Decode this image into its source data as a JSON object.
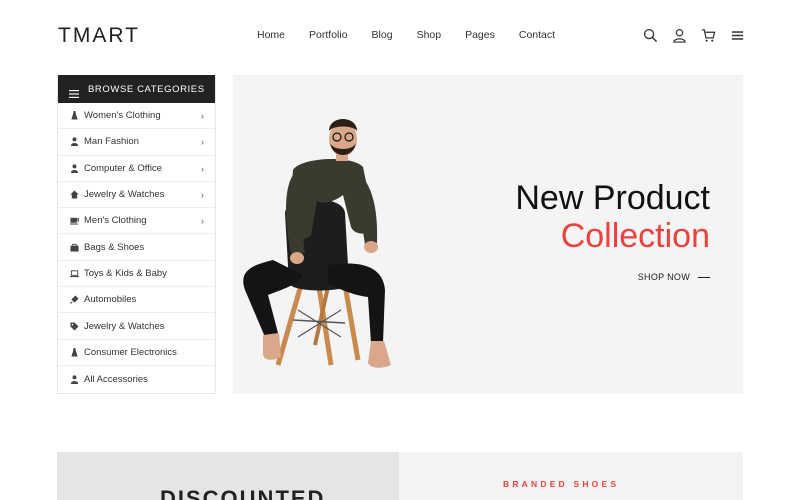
{
  "header": {
    "logo": "TMART",
    "nav": [
      "Home",
      "Portfolio",
      "Blog",
      "Shop",
      "Pages",
      "Contact"
    ],
    "icons": [
      "search-icon",
      "user-icon",
      "cart-icon",
      "menu-icon"
    ]
  },
  "sidebar": {
    "title": "BROWSE CATEGORIES",
    "items": [
      {
        "label": "Women's Clothing",
        "icon": "dress-icon",
        "arrow": true
      },
      {
        "label": "Man Fashion",
        "icon": "person-icon",
        "arrow": true
      },
      {
        "label": "Computer & Office",
        "icon": "person-icon",
        "arrow": true
      },
      {
        "label": "Jewelry & Watches",
        "icon": "home-icon",
        "arrow": true
      },
      {
        "label": "Men's Clothing",
        "icon": "coffee-icon",
        "arrow": true
      },
      {
        "label": "Bags & Shoes",
        "icon": "bag-icon",
        "arrow": false
      },
      {
        "label": "Toys & Kids & Baby",
        "icon": "laptop-icon",
        "arrow": false
      },
      {
        "label": "Automobiles",
        "icon": "plug-icon",
        "arrow": false
      },
      {
        "label": "Jewelry & Watches",
        "icon": "tag-icon",
        "arrow": false
      },
      {
        "label": "Consumer Electronics",
        "icon": "dress-icon",
        "arrow": false
      },
      {
        "label": "All Accessories",
        "icon": "person-icon",
        "arrow": false
      }
    ]
  },
  "hero": {
    "title_line1": "New Product",
    "title_line2": "Collection",
    "cta": "SHOP NOW"
  },
  "banners": {
    "left_text": "DISCOUNTED",
    "right_text": "BRANDED SHOES"
  },
  "colors": {
    "accent": "#e9423f",
    "dark": "#222222",
    "hero_bg": "#f4f4f4"
  }
}
